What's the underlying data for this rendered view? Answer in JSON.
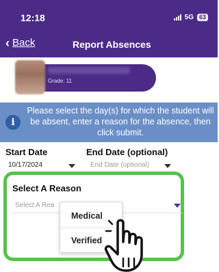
{
  "status_bar": {
    "time": "12:18",
    "network": "5G",
    "battery": "63"
  },
  "nav": {
    "back_label": "Back",
    "title": "Report Absences"
  },
  "student": {
    "grade": "Grade: 11"
  },
  "info": {
    "message": "Please select the day(s) for which the student will be absent, enter a reason for the absence, then click submit."
  },
  "dates": {
    "start_label": "Start Date",
    "start_value": "10/17/2024",
    "end_label": "End Date (optional)",
    "end_placeholder": "End Date (optional)"
  },
  "reason": {
    "title": "Select A Reason",
    "placeholder": "Select A Rea",
    "options": [
      "Medical",
      "Verified"
    ]
  },
  "colors": {
    "header": "#4c2a87",
    "banner": "#6a8fc7",
    "highlight": "#56c24b"
  }
}
